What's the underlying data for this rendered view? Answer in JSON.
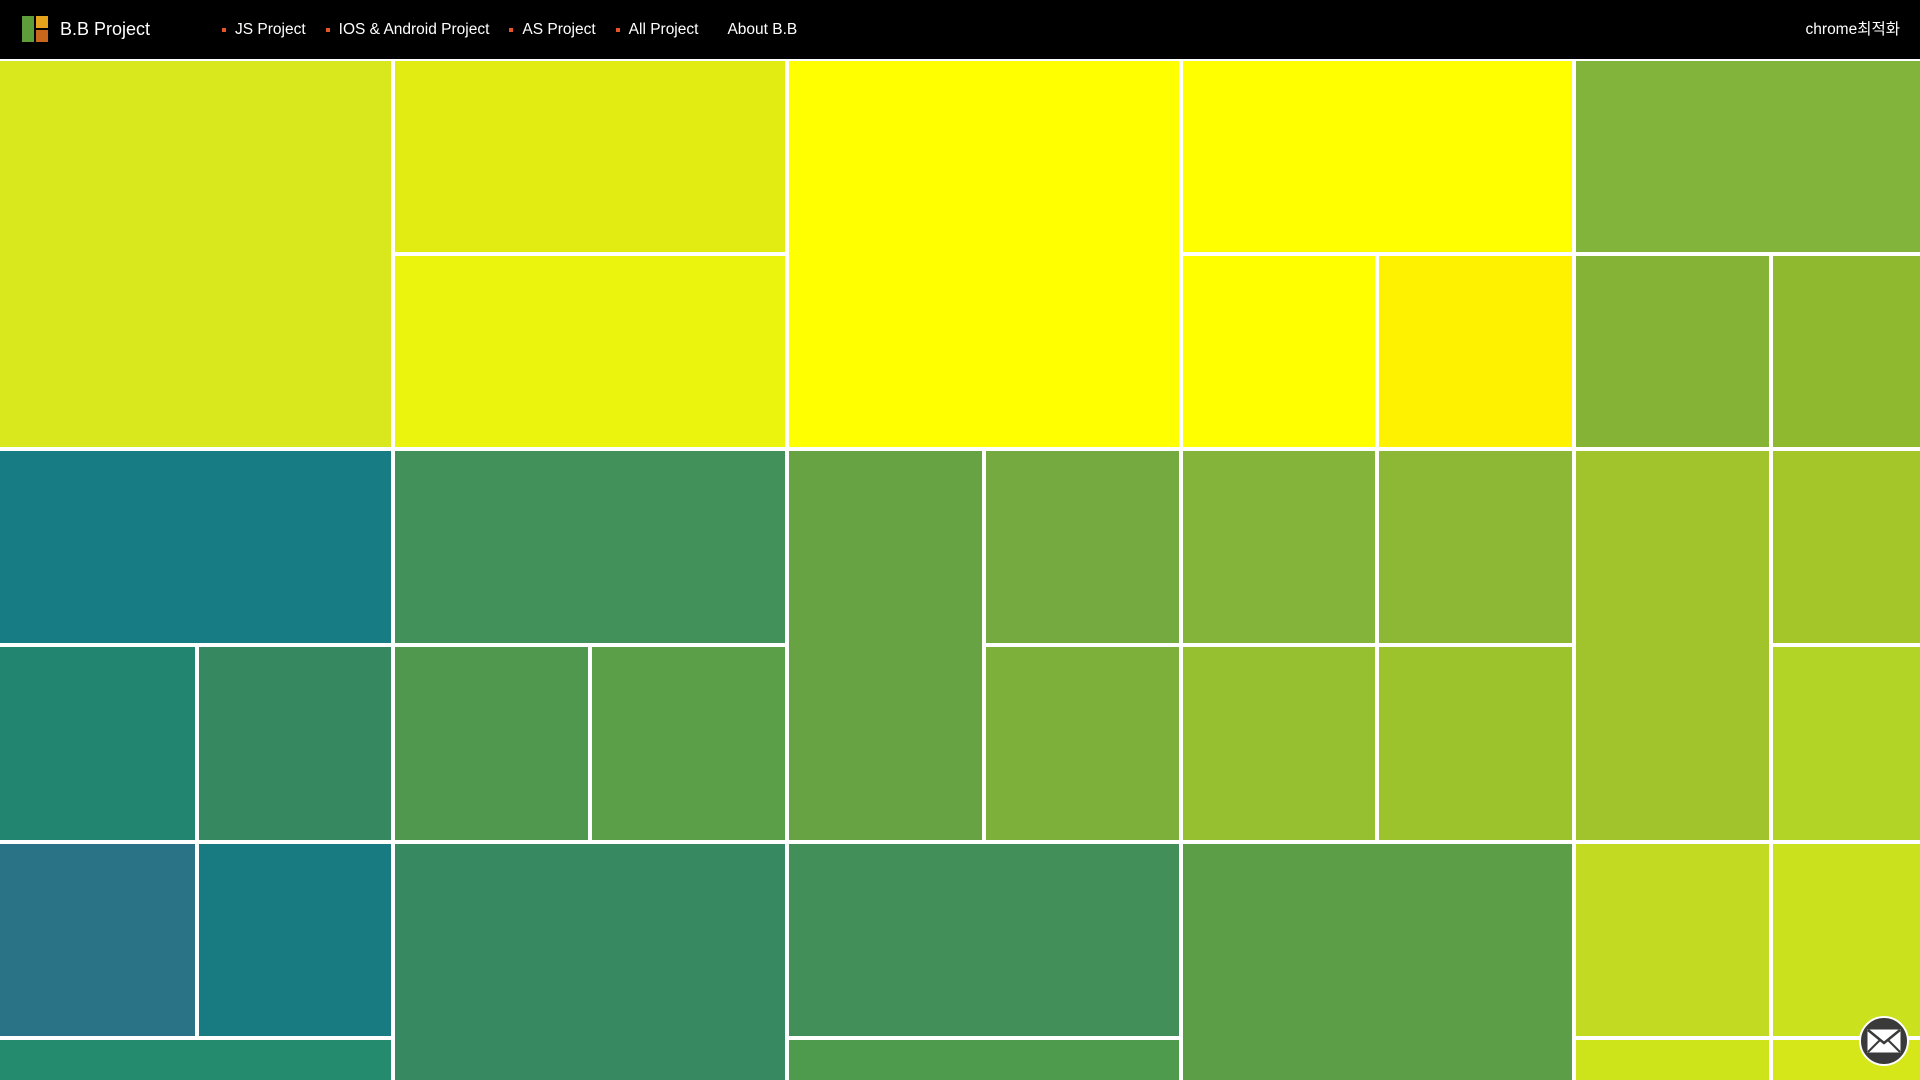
{
  "header": {
    "brand": "B.B Project",
    "logo_colors": [
      "#5d9e3a",
      "#e6a31c",
      "#c9671d"
    ],
    "nav": [
      {
        "label": "JS Project",
        "bullet": true
      },
      {
        "label": "IOS & Android Project",
        "bullet": true
      },
      {
        "label": "AS Project",
        "bullet": true
      },
      {
        "label": "All Project",
        "bullet": true
      },
      {
        "label": "About B.B",
        "bullet": false
      }
    ],
    "bullet_color": "#e8542a",
    "browser_note": "chrome최적화",
    "background": "#000000"
  },
  "tiles": {
    "colors": [
      "#d8e81c",
      "#e2ec12",
      "#eaf40c",
      "#ffff00",
      "#ffff00",
      "#ffff00",
      "#fff200",
      "#82b33a",
      "#84b335",
      "#8fba30",
      "#177c83",
      "#43915a",
      "#68a343",
      "#74aa40",
      "#84b43a",
      "#8db836",
      "#a1c42d",
      "#a5c629",
      "#22856f",
      "#35885f",
      "#51984f",
      "#5c9f49",
      "#7cb03b",
      "#97c031",
      "#9dc32c",
      "#b1d427",
      "#2a7386",
      "#187b81",
      "#368960",
      "#428f59",
      "#5c9e48",
      "#c2da22",
      "#cae11d",
      "#258b6e",
      "#4e9b4d",
      "#cde41a",
      "#d5e619"
    ]
  },
  "mail": {
    "icon": "mail-icon",
    "background": "#3a3a3a"
  }
}
